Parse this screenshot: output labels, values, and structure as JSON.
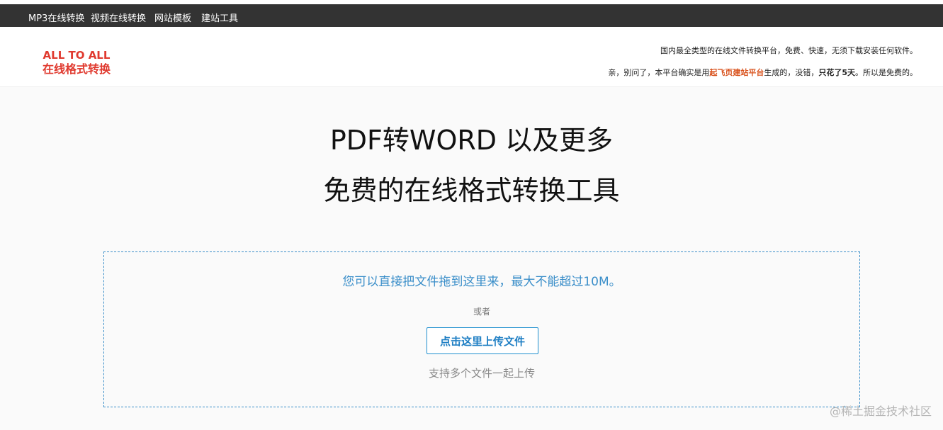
{
  "nav": {
    "items": [
      {
        "label": "MP3在线转换"
      },
      {
        "label": "视频在线转换"
      },
      {
        "label": "网站模板"
      },
      {
        "label": "建站工具"
      }
    ]
  },
  "header": {
    "logo": {
      "line1": "ALL TO ALL",
      "line2": "在线格式转换"
    },
    "tagline1": "国内最全类型的在线文件转换平台，免费、快速，无须下载安装任何软件。",
    "tagline2": {
      "prefix": "亲，别问了，本平台确实是用",
      "link": "起飞页建站平台",
      "middle": "生成的，没错，",
      "emphasis": "只花了5天",
      "suffix": "。所以是免费的。"
    }
  },
  "hero": {
    "line1": "PDF转WORD 以及更多",
    "line2": "免费的在线格式转换工具"
  },
  "upload": {
    "drop_hint": "您可以直接把文件拖到这里来，最大不能超过10M。",
    "or_text": "或者",
    "button_label": "点击这里上传文件",
    "multi_hint": "支持多个文件一起上传"
  },
  "watermark": "@稀土掘金技术社区",
  "colors": {
    "navbar_bg": "#333333",
    "logo": "#e03a2f",
    "accent_link": "#d9531e",
    "dropzone_border": "#3a8ec9",
    "button_border": "#1f8fcf"
  }
}
